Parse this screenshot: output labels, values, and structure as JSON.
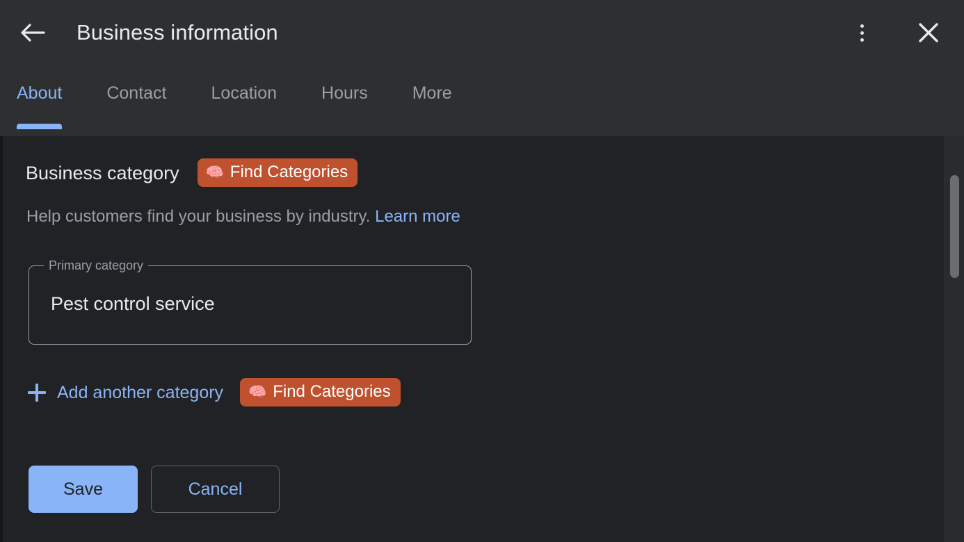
{
  "window": {
    "title": "Business information",
    "back_icon": "arrow-left-icon",
    "overflow_icon": "more-vert-icon",
    "close_icon": "close-icon"
  },
  "tabs": {
    "active_index": 0,
    "items": [
      {
        "label": "About"
      },
      {
        "label": "Contact"
      },
      {
        "label": "Location"
      },
      {
        "label": "Hours"
      },
      {
        "label": "More"
      }
    ]
  },
  "content": {
    "section_title": "Business category",
    "description_text": "Help customers find your business by industry.",
    "learn_more_label": "Learn more",
    "primary_category": {
      "label": "Primary category",
      "value": "Pest control service",
      "placeholder": "Primary category"
    },
    "add_another": {
      "plus_icon": "plus-icon",
      "label": "Add another category"
    },
    "find_categories_badge": {
      "icon": "brain-icon",
      "glyph": "🧠",
      "label": "Find Categories"
    },
    "actions": {
      "save_label": "Save",
      "cancel_label": "Cancel"
    }
  },
  "colors": {
    "accent_blue": "#8ab4f8",
    "badge_orange": "#c0512f",
    "header_bg": "#2d2f31",
    "content_bg": "#212225",
    "text_primary": "#e8eaed",
    "text_secondary": "#9aa0a6"
  }
}
